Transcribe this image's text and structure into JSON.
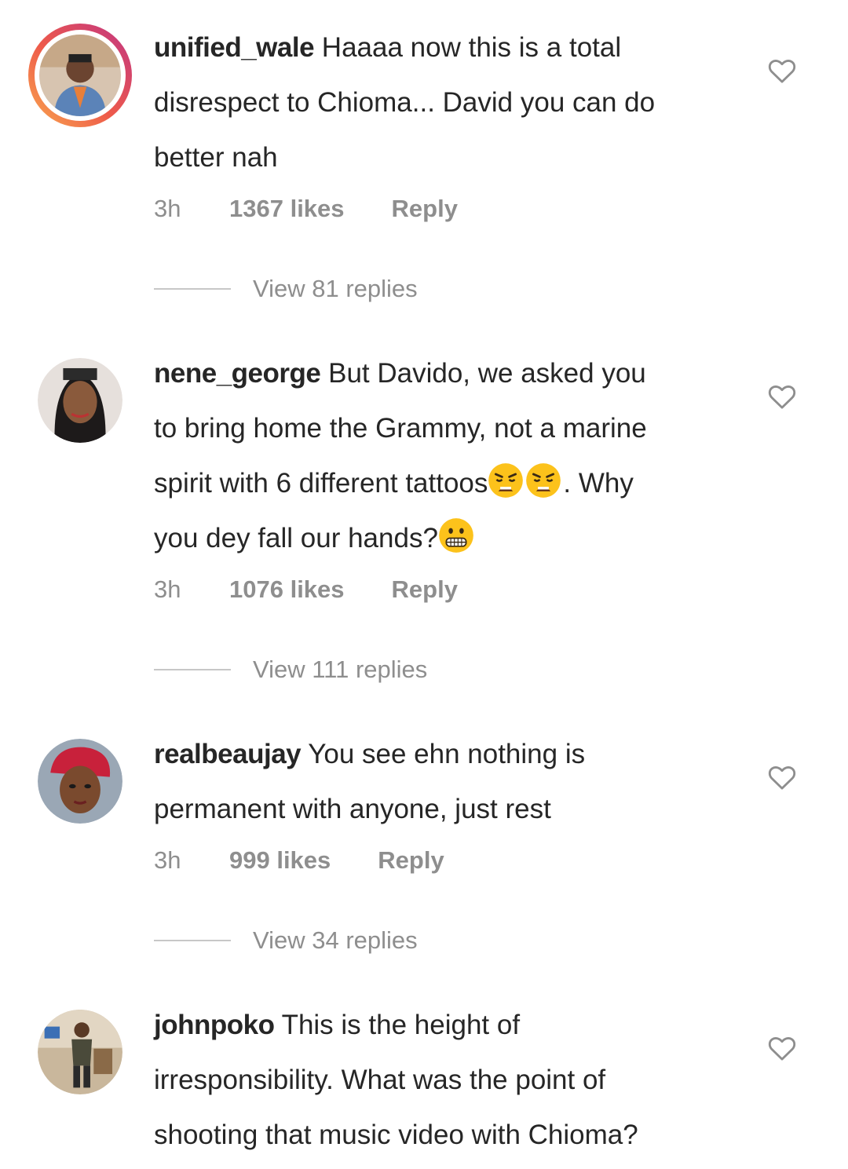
{
  "comments": [
    {
      "username": "unified_wale",
      "text": "Haaaa now this is a total disrespect to Chioma... David you can do better nah",
      "lines": [
        "Haaaa now this is a total",
        "disrespect to Chioma... David you can do",
        "better nah"
      ],
      "time": "3h",
      "likes": "1367 likes",
      "reply": "Reply",
      "view_replies": "View 81 replies"
    },
    {
      "username": "nene_george",
      "lines": [
        "But Davido, we asked you",
        "to bring home the Grammy, not a marine",
        "spirit with 6 different tattoos",
        ". Why",
        "you dey fall our hands?"
      ],
      "time": "3h",
      "likes": "1076 likes",
      "reply": "Reply",
      "view_replies": "View 111 replies"
    },
    {
      "username": "realbeaujay",
      "lines": [
        "You see ehn nothing is",
        "permanent with anyone, just rest"
      ],
      "time": "3h",
      "likes": "999 likes",
      "reply": "Reply",
      "view_replies": "View 34 replies"
    },
    {
      "username": "johnpoko",
      "lines": [
        "This is the height of",
        "irresponsibility. What was the point of",
        "shooting that music video with Chioma?"
      ]
    }
  ],
  "icons": {
    "like": "heart-outline-icon",
    "emoji_weary": "weary-face-emoji",
    "emoji_grimace": "grimacing-face-emoji"
  },
  "colors": {
    "text": "#262626",
    "meta": "#8e8e8e",
    "divider": "#c7c7c7",
    "story_ring_start": "#f9a94f",
    "story_ring_end": "#c13584"
  }
}
